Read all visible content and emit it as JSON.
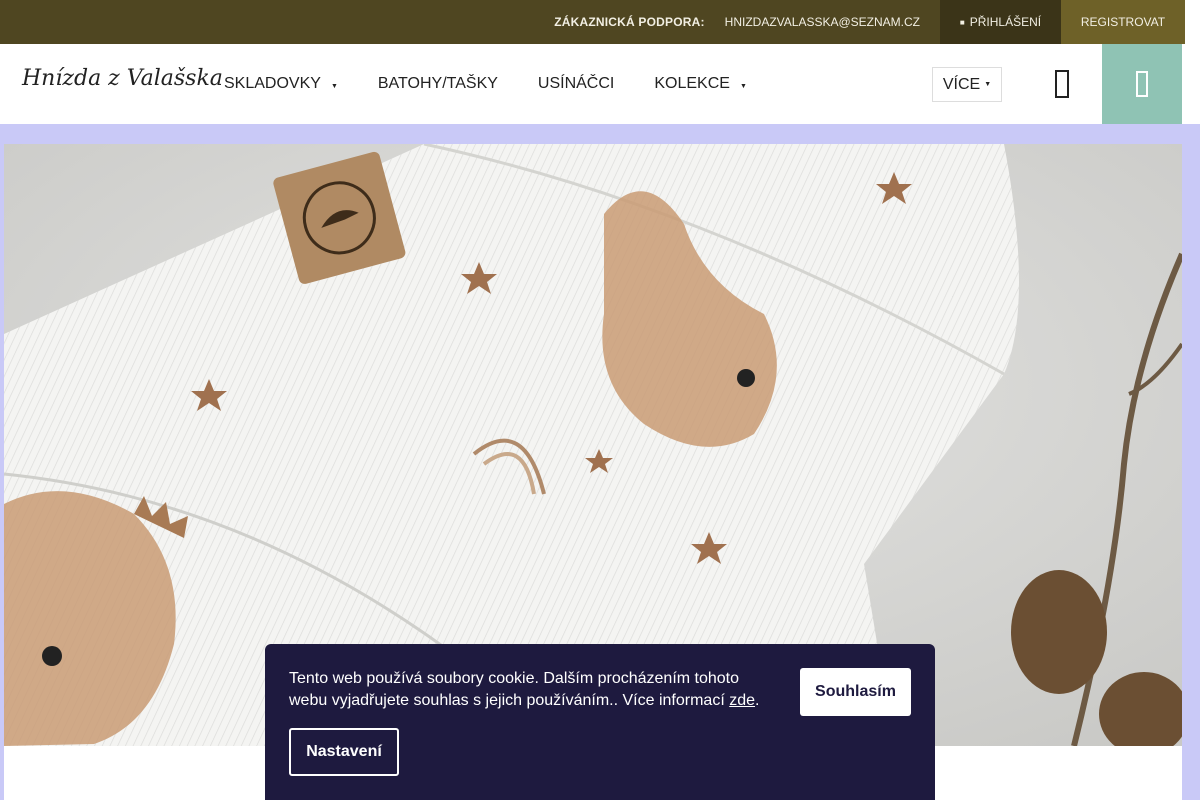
{
  "topbar": {
    "support_label": "ZÁKAZNICKÁ PODPORA:",
    "support_email": "HNIZDAZVALASSKA@SEZNAM.CZ",
    "login_label": "PŘIHLÁŠENÍ",
    "register_label": "REGISTROVAT"
  },
  "header": {
    "logo_text": "Hnízda z Valašska",
    "nav": [
      {
        "label": "SKLADOVKY",
        "has_dropdown": true
      },
      {
        "label": "BATOHY/TAŠKY",
        "has_dropdown": false
      },
      {
        "label": "USÍNÁČCI",
        "has_dropdown": false
      },
      {
        "label": "KOLEKCE",
        "has_dropdown": true
      }
    ],
    "more_label": "VÍCE",
    "search_icon": "search-icon",
    "cart_icon": "cart-icon"
  },
  "colors": {
    "topbar_bg": "#4f4621",
    "login_bg": "#3b3418",
    "register_bg": "#6e6128",
    "cart_bg": "#8fc3b4",
    "page_bg": "#c9c9f7",
    "cookie_bg": "#1e1a3f"
  },
  "cookie": {
    "text": "Tento web používá soubory cookie. Dalším procházením tohoto webu vyjadřujete souhlas s jejich používáním.. Více informací ",
    "link_text": "zde",
    "text_end": ".",
    "accept_label": "Souhlasím",
    "settings_label": "Nastavení"
  }
}
